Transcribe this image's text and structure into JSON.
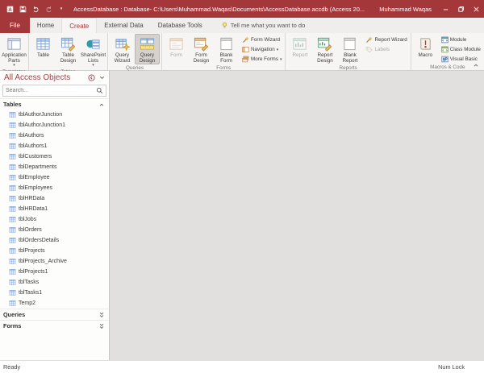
{
  "title_bar": {
    "title": "AccessDatabase : Database- C:\\Users\\Muhammad.Waqas\\Documents\\AccessDatabase.accdb (Access 20...",
    "user_name": "Muhammad Waqas"
  },
  "ribbon": {
    "tabs": [
      "File",
      "Home",
      "Create",
      "External Data",
      "Database Tools"
    ],
    "active_tab": "Create",
    "tell_me": "Tell me what you want to do",
    "groups": {
      "templates": {
        "label": "Templates",
        "application_parts": "Application Parts"
      },
      "tables": {
        "label": "Tables",
        "table": "Table",
        "table_design": "Table Design",
        "sharepoint_lists": "SharePoint Lists"
      },
      "queries": {
        "label": "Queries",
        "query_wizard": "Query Wizard",
        "query_design": "Query Design",
        "selected_button": "Query Design"
      },
      "forms": {
        "label": "Forms",
        "form": "Form",
        "form_design": "Form Design",
        "blank_form": "Blank Form",
        "form_wizard": "Form Wizard",
        "navigation": "Navigation",
        "more_forms": "More Forms"
      },
      "reports": {
        "label": "Reports",
        "report": "Report",
        "report_design": "Report Design",
        "blank_report": "Blank Report",
        "report_wizard": "Report Wizard",
        "labels": "Labels"
      },
      "macros": {
        "label": "Macros & Code",
        "macro": "Macro",
        "module": "Module",
        "class_module": "Class Module",
        "visual_basic": "Visual Basic"
      }
    }
  },
  "nav_pane": {
    "title": "All Access Objects",
    "search_placeholder": "Search...",
    "sections": {
      "tables": {
        "label": "Tables",
        "items": [
          "tblAuthorJunction",
          "tblAuthorJunction1",
          "tblAuthors",
          "tblAuthors1",
          "tblCustomers",
          "tblDepartments",
          "tblEmployee",
          "tblEmployees",
          "tblHRData",
          "tblHRData1",
          "tblJobs",
          "tblOrders",
          "tblOrdersDetails",
          "tblProjects",
          "tblProjects_Archive",
          "tblProjects1",
          "tblTasks",
          "tblTasks1",
          "Temp2"
        ]
      },
      "queries": {
        "label": "Queries"
      },
      "forms": {
        "label": "Forms"
      }
    }
  },
  "status_bar": {
    "ready": "Ready",
    "num_lock": "Num Lock"
  },
  "colors": {
    "accent": "#A4373A",
    "ribbon_bg": "#F7F5F4",
    "canvas_bg": "#E2E0DE"
  }
}
